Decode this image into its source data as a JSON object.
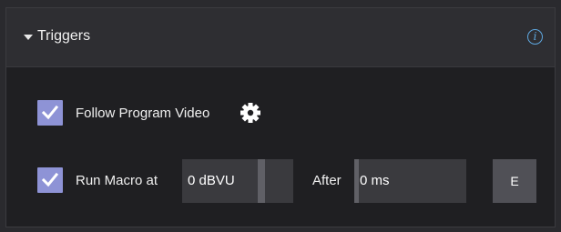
{
  "triggers": {
    "title": "Triggers",
    "info_icon": "info-icon",
    "follow_program_video": {
      "checked": true,
      "label": "Follow Program Video",
      "icon": "gear-icon"
    },
    "run_macro": {
      "checked": true,
      "label": "Run Macro at",
      "level_value": "0 dBVU",
      "after_label": "After",
      "after_value": "0 ms",
      "button_label": "E"
    }
  },
  "colors": {
    "checkbox": "#8e93d6",
    "info": "#5ea7df",
    "panel_bg": "#1f1f22",
    "header_bg": "#2e2e32"
  }
}
